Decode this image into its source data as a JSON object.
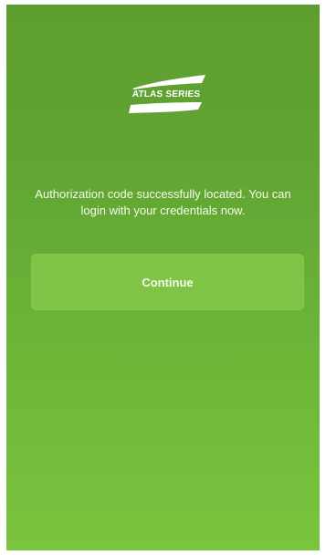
{
  "logo": {
    "text": "ATLAS SERIES"
  },
  "message": "Authorization code successfully located. You can login with your credentials now.",
  "continue_button": {
    "label": "Continue"
  },
  "colors": {
    "background_top": "#5e9e2f",
    "background_bottom": "#7bc43f",
    "button": "#80c447",
    "text": "#f4fbe9"
  }
}
